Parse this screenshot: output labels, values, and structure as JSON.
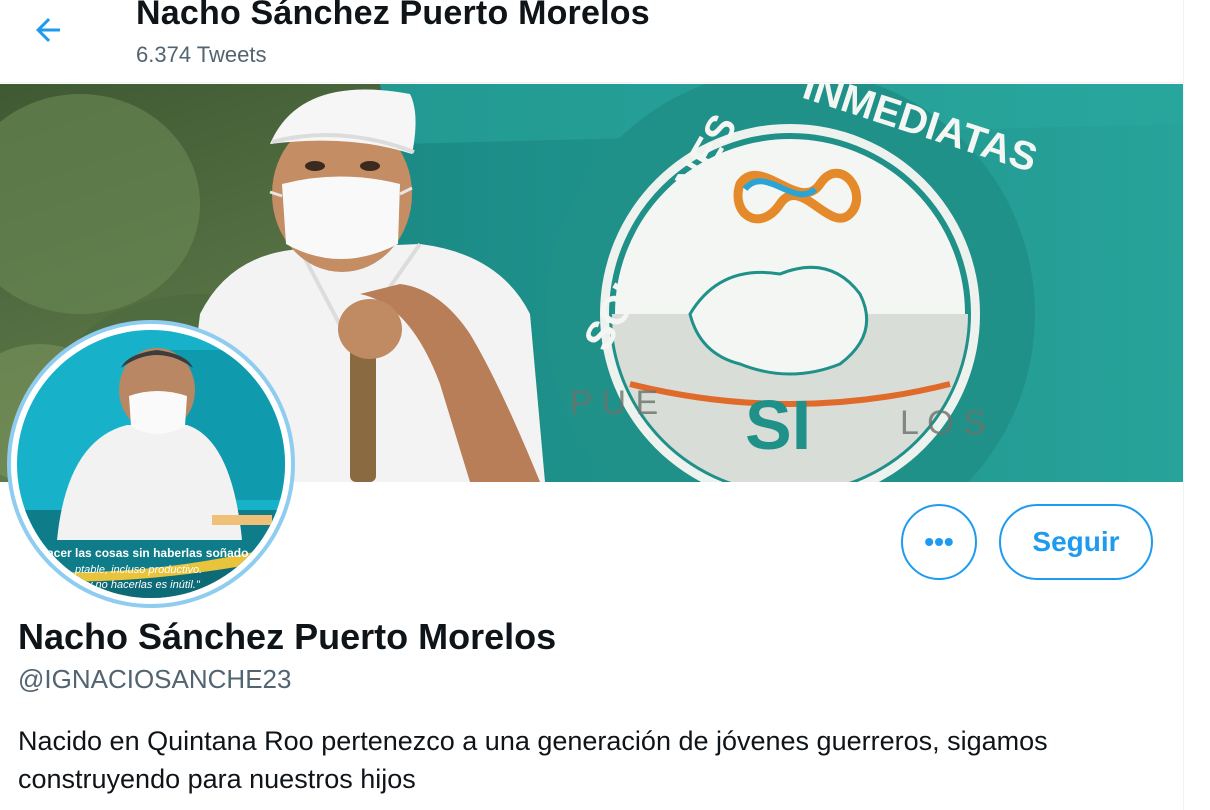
{
  "header": {
    "back_icon": "arrow-left-icon",
    "title": "Nacho Sánchez Puerto Morelos",
    "tweet_count": "6.374 Tweets"
  },
  "banner": {
    "flag_text_top": "SOLUCIONES INMEDIATAS",
    "flag_text_bottom": "PUERTO MORELOS",
    "flag_logo": "SI",
    "colors": {
      "teal": "#1f8f88",
      "white": "#f2f4f1",
      "orange": "#e06a2a"
    }
  },
  "avatar": {
    "caption_line1": "acer las cosas sin haberlas soñado",
    "caption_line2": "ptable, incluso productivo.",
    "caption_line3": "y no hacerlas es inútil.\""
  },
  "actions": {
    "more_icon": "more-horizontal-icon",
    "more_label": "•••",
    "follow_label": "Seguir"
  },
  "profile": {
    "display_name": "Nacho Sánchez Puerto Morelos",
    "handle": "@IGNACIOSANCHE23",
    "bio": "Nacido en Quintana Roo pertenezco a una generación de jóvenes guerreros, sigamos construyendo para nuestros hijos"
  },
  "theme": {
    "accent": "#1d9bf0",
    "text": "#0f1419",
    "muted": "#536471"
  }
}
